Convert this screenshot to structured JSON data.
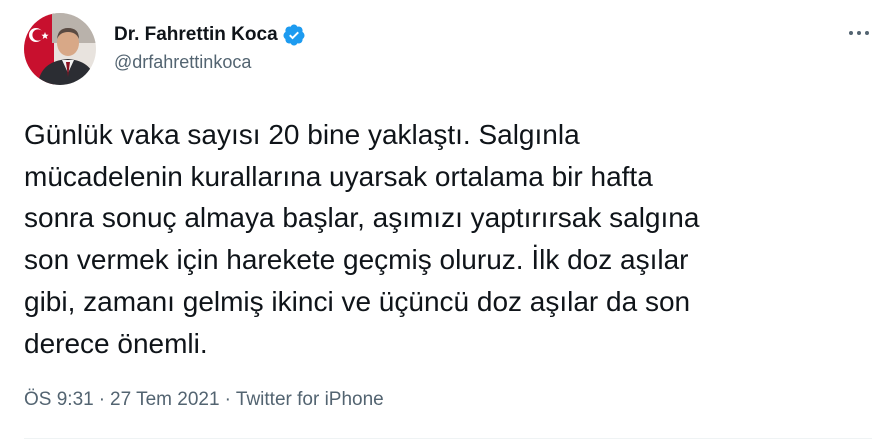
{
  "author": {
    "display_name": "Dr. Fahrettin Koca",
    "handle": "@drfahrettinkoca",
    "verified_icon": "verified-badge-icon",
    "avatar_icon": "profile-photo"
  },
  "tweet": {
    "text": "Günlük vaka sayısı 20 bine yaklaştı. Salgınla\nmücadelenin kurallarına uyarsak ortalama bir hafta\nsonra sonuç almaya başlar, aşımızı yaptırırsak salgına\nson vermek için harekete geçmiş oluruz. İlk doz aşılar\ngibi, zamanı gelmiş ikinci ve üçüncü doz aşılar da son\nderece önemli."
  },
  "meta": {
    "time": "ÖS 9:31",
    "separator": "·",
    "date": "27 Tem 2021",
    "source": "Twitter for iPhone"
  },
  "colors": {
    "verified_blue": "#1d9bf0",
    "secondary_text": "#536471",
    "primary_text": "#0f1419"
  }
}
